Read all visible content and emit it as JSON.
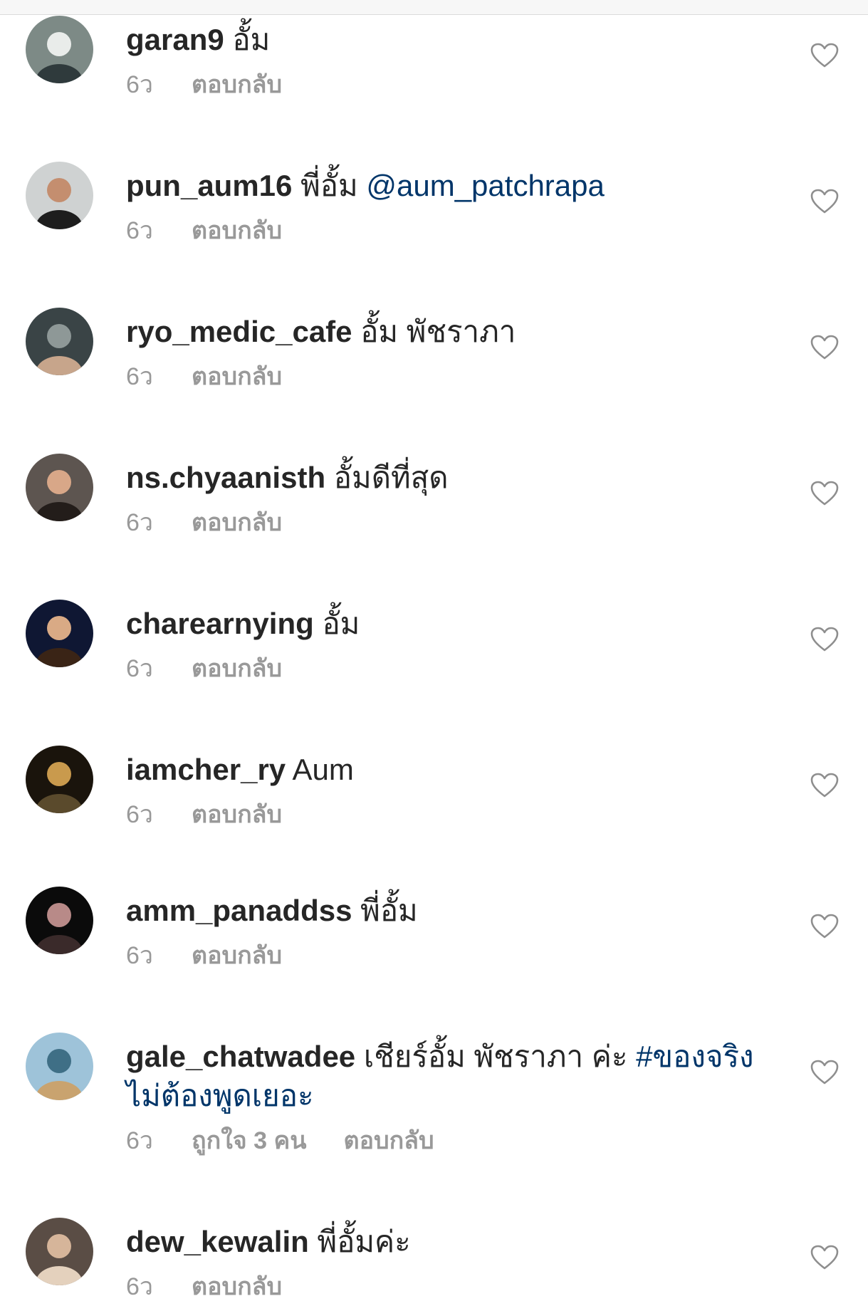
{
  "comments": [
    {
      "username": "garan9",
      "text": "อั้ม",
      "mention": "",
      "hashtag": "",
      "time": "6ว",
      "likes": "",
      "reply": "ตอบกลับ",
      "avatar": {
        "bg": "#7d8a86",
        "fg": "#e9ecea",
        "accent": "#2f3a3c"
      }
    },
    {
      "username": "pun_aum16",
      "text": "พี่อั้ม",
      "mention": "@aum_patchrapa",
      "hashtag": "",
      "time": "6ว",
      "likes": "",
      "reply": "ตอบกลับ",
      "avatar": {
        "bg": "#cfd2d2",
        "fg": "#c48e6f",
        "accent": "#1d1d1d"
      }
    },
    {
      "username": "ryo_medic_cafe",
      "text": "อั้ม พัชราภา",
      "mention": "",
      "hashtag": "",
      "time": "6ว",
      "likes": "",
      "reply": "ตอบกลับ",
      "avatar": {
        "bg": "#3a4446",
        "fg": "#8e9897",
        "accent": "#c7a58b"
      }
    },
    {
      "username": "ns.chyaanisth",
      "text": "อั้มดีที่สุด",
      "mention": "",
      "hashtag": "",
      "time": "6ว",
      "likes": "",
      "reply": "ตอบกลับ",
      "avatar": {
        "bg": "#5d5550",
        "fg": "#d8a788",
        "accent": "#231d1a"
      }
    },
    {
      "username": "charearnying",
      "text": "อั้ม",
      "mention": "",
      "hashtag": "",
      "time": "6ว",
      "likes": "",
      "reply": "ตอบกลับ",
      "avatar": {
        "bg": "#0f1733",
        "fg": "#d9aa85",
        "accent": "#3a2416"
      }
    },
    {
      "username": "iamcher_ry",
      "text": "Aum",
      "mention": "",
      "hashtag": "",
      "time": "6ว",
      "likes": "",
      "reply": "ตอบกลับ",
      "avatar": {
        "bg": "#1a140c",
        "fg": "#c99a4d",
        "accent": "#5a4a2c"
      }
    },
    {
      "username": "amm_panaddss",
      "text": "พี่อั้ม",
      "mention": "",
      "hashtag": "",
      "time": "6ว",
      "likes": "",
      "reply": "ตอบกลับ",
      "avatar": {
        "bg": "#0b0b0b",
        "fg": "#b88a88",
        "accent": "#3a2a2a"
      }
    },
    {
      "username": "gale_chatwadee",
      "text": "เชียร์อั้ม พัชราภา ค่ะ",
      "mention": "",
      "hashtag": "#ของจริงไม่ต้องพูดเยอะ",
      "time": "6ว",
      "likes": "ถูกใจ 3 คน",
      "reply": "ตอบกลับ",
      "avatar": {
        "bg": "#9ec3d9",
        "fg": "#3f6f86",
        "accent": "#c9a36f"
      }
    },
    {
      "username": "dew_kewalin",
      "text": "พี่อั้มค่ะ",
      "mention": "",
      "hashtag": "",
      "time": "6ว",
      "likes": "",
      "reply": "ตอบกลับ",
      "avatar": {
        "bg": "#5a4d45",
        "fg": "#d6b59a",
        "accent": "#e4d1bd"
      }
    }
  ],
  "colors": {
    "text": "#262626",
    "meta": "#999999",
    "link": "#003569",
    "heart": "#8e8e8e"
  },
  "icons": {
    "heart": "heart-outline-icon"
  }
}
